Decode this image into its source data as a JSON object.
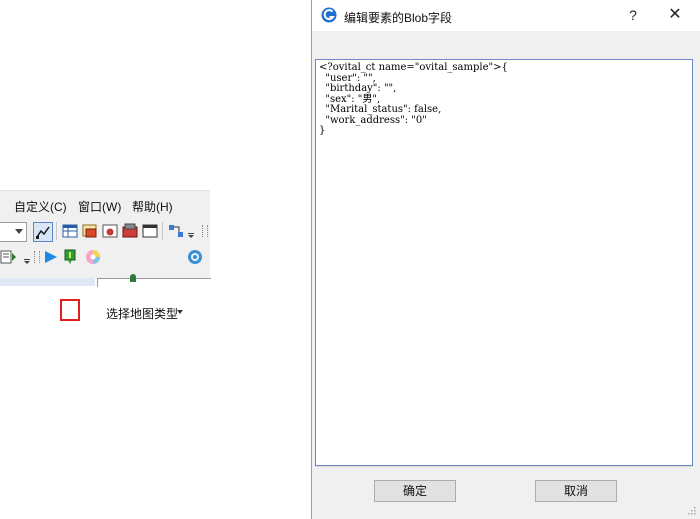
{
  "toolbar": {
    "menus": [
      {
        "label": "自定义(C)"
      },
      {
        "label": "窗口(W)"
      },
      {
        "label": "帮助(H)"
      }
    ],
    "map_type_label": "选择地图类型",
    "colors": {
      "highlight": "#e02020",
      "play": "#1e88e5",
      "pin": "#2e9e3a"
    },
    "icons": [
      "dropdown-icon",
      "pointer-tool-icon",
      "table-icon",
      "layer-icon",
      "map-icon",
      "stack-icon",
      "window-icon",
      "network-icon",
      "overflow-icon",
      "properties-icon",
      "play-icon",
      "map-pin-icon",
      "color-wheel-icon",
      "gear-icon"
    ]
  },
  "dialog": {
    "title": "编辑要素的Blob字段",
    "help_label": "?",
    "close_label": "✕",
    "content": "<?ovital_ct name=\"ovital_sample\">{\n  \"user\": \"\",\n  \"birthday\": \"\",\n  \"sex\": \"男\",\n  \"Marital_status\": false,\n  \"work_address\": \"0\"\n}",
    "ok_label": "确定",
    "cancel_label": "取消",
    "colors": {
      "textarea_border": "#6a8cc2",
      "background": "#f0f0f0"
    }
  }
}
